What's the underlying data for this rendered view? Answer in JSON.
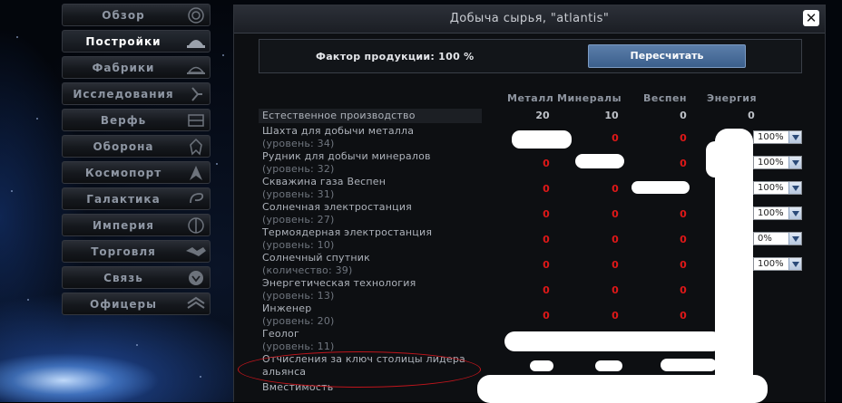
{
  "menu": {
    "items": [
      {
        "label": "Обзор",
        "icon": "overview-icon"
      },
      {
        "label": "Постройки",
        "icon": "buildings-icon"
      },
      {
        "label": "Фабрики",
        "icon": "factories-icon"
      },
      {
        "label": "Исследования",
        "icon": "research-icon"
      },
      {
        "label": "Верфь",
        "icon": "shipyard-icon"
      },
      {
        "label": "Оборона",
        "icon": "defense-icon"
      },
      {
        "label": "Космопорт",
        "icon": "spaceport-icon"
      },
      {
        "label": "Галактика",
        "icon": "galaxy-icon"
      },
      {
        "label": "Империя",
        "icon": "empire-icon"
      },
      {
        "label": "Торговля",
        "icon": "trade-icon"
      },
      {
        "label": "Связь",
        "icon": "communication-icon"
      },
      {
        "label": "Офицеры",
        "icon": "officers-icon"
      }
    ],
    "active_index": 1
  },
  "window": {
    "title": "Добыча сырья, \"atlantis\"",
    "close_icon": "close-icon",
    "factor_label": "Фактор продукции: 100 %",
    "recalc_label": "Пересчитать"
  },
  "columns": [
    "Металл",
    "Минералы",
    "Веспен",
    "Энергия"
  ],
  "natural": {
    "label": "Естественное производство",
    "values": [
      "20",
      "10",
      "0",
      "0"
    ]
  },
  "rows": [
    {
      "name": "Шахта для добычи металла",
      "sub": "(уровень: 34)",
      "values": [
        "",
        "0",
        "0",
        ""
      ],
      "select": "100%"
    },
    {
      "name": "Рудник для добычи минералов",
      "sub": "(уровень: 32)",
      "values": [
        "0",
        "",
        "0",
        ""
      ],
      "select": "100%"
    },
    {
      "name": "Скважина газа Веспен",
      "sub": "(уровень: 31)",
      "values": [
        "0",
        "0",
        "",
        ""
      ],
      "select": "100%"
    },
    {
      "name": "Солнечная электростанция",
      "sub": "(уровень: 27)",
      "values": [
        "0",
        "0",
        "0",
        ""
      ],
      "select": "100%"
    },
    {
      "name": "Термоядерная электростанция",
      "sub": "(уровень: 10)",
      "values": [
        "0",
        "0",
        "0",
        ""
      ],
      "select": "0%"
    },
    {
      "name": "Солнечный спутник",
      "sub": "(количество: 39)",
      "values": [
        "0",
        "0",
        "0",
        ""
      ],
      "select": "100%"
    },
    {
      "name": "Энергетическая технология",
      "sub": "(уровень: 13)",
      "values": [
        "0",
        "0",
        "0",
        ""
      ]
    },
    {
      "name": "Инженер",
      "sub": "(уровень: 20)",
      "values": [
        "0",
        "0",
        "0",
        ""
      ]
    },
    {
      "name": "Геолог",
      "sub": "(уровень: 11)",
      "values": [
        "",
        "",
        "",
        ""
      ]
    },
    {
      "name": "Отчисления за ключ столицы лидера альянса",
      "sub": "",
      "values": [
        "",
        "",
        "",
        ""
      ]
    },
    {
      "name": "Вместимость",
      "sub": "",
      "values": [
        "",
        "",
        "",
        ""
      ]
    }
  ],
  "colors": {
    "negative": "#e01818",
    "accent": "#4a6e9c",
    "annotation": "#c0151c"
  }
}
